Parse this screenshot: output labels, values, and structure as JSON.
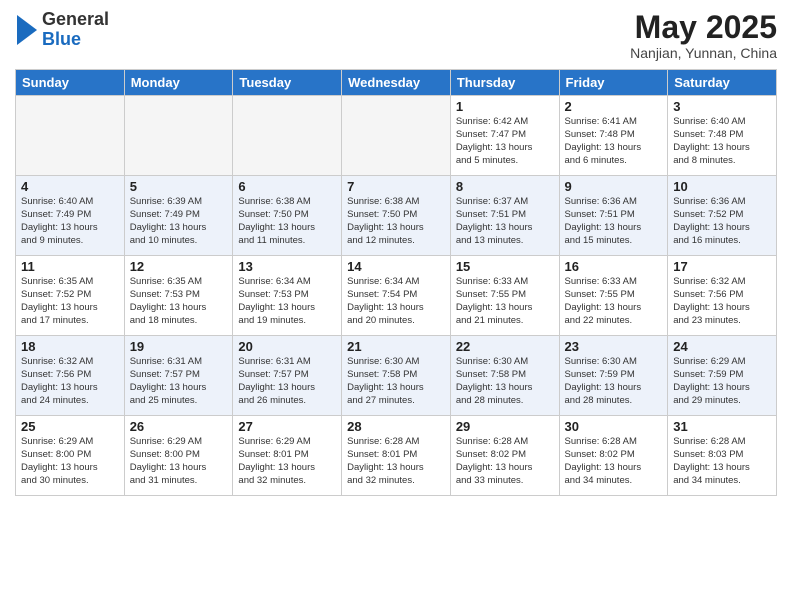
{
  "header": {
    "logo_general": "General",
    "logo_blue": "Blue",
    "month_year": "May 2025",
    "location": "Nanjian, Yunnan, China"
  },
  "weekdays": [
    "Sunday",
    "Monday",
    "Tuesday",
    "Wednesday",
    "Thursday",
    "Friday",
    "Saturday"
  ],
  "weeks": [
    [
      {
        "day": "",
        "info": ""
      },
      {
        "day": "",
        "info": ""
      },
      {
        "day": "",
        "info": ""
      },
      {
        "day": "",
        "info": ""
      },
      {
        "day": "1",
        "info": "Sunrise: 6:42 AM\nSunset: 7:47 PM\nDaylight: 13 hours\nand 5 minutes."
      },
      {
        "day": "2",
        "info": "Sunrise: 6:41 AM\nSunset: 7:48 PM\nDaylight: 13 hours\nand 6 minutes."
      },
      {
        "day": "3",
        "info": "Sunrise: 6:40 AM\nSunset: 7:48 PM\nDaylight: 13 hours\nand 8 minutes."
      }
    ],
    [
      {
        "day": "4",
        "info": "Sunrise: 6:40 AM\nSunset: 7:49 PM\nDaylight: 13 hours\nand 9 minutes."
      },
      {
        "day": "5",
        "info": "Sunrise: 6:39 AM\nSunset: 7:49 PM\nDaylight: 13 hours\nand 10 minutes."
      },
      {
        "day": "6",
        "info": "Sunrise: 6:38 AM\nSunset: 7:50 PM\nDaylight: 13 hours\nand 11 minutes."
      },
      {
        "day": "7",
        "info": "Sunrise: 6:38 AM\nSunset: 7:50 PM\nDaylight: 13 hours\nand 12 minutes."
      },
      {
        "day": "8",
        "info": "Sunrise: 6:37 AM\nSunset: 7:51 PM\nDaylight: 13 hours\nand 13 minutes."
      },
      {
        "day": "9",
        "info": "Sunrise: 6:36 AM\nSunset: 7:51 PM\nDaylight: 13 hours\nand 15 minutes."
      },
      {
        "day": "10",
        "info": "Sunrise: 6:36 AM\nSunset: 7:52 PM\nDaylight: 13 hours\nand 16 minutes."
      }
    ],
    [
      {
        "day": "11",
        "info": "Sunrise: 6:35 AM\nSunset: 7:52 PM\nDaylight: 13 hours\nand 17 minutes."
      },
      {
        "day": "12",
        "info": "Sunrise: 6:35 AM\nSunset: 7:53 PM\nDaylight: 13 hours\nand 18 minutes."
      },
      {
        "day": "13",
        "info": "Sunrise: 6:34 AM\nSunset: 7:53 PM\nDaylight: 13 hours\nand 19 minutes."
      },
      {
        "day": "14",
        "info": "Sunrise: 6:34 AM\nSunset: 7:54 PM\nDaylight: 13 hours\nand 20 minutes."
      },
      {
        "day": "15",
        "info": "Sunrise: 6:33 AM\nSunset: 7:55 PM\nDaylight: 13 hours\nand 21 minutes."
      },
      {
        "day": "16",
        "info": "Sunrise: 6:33 AM\nSunset: 7:55 PM\nDaylight: 13 hours\nand 22 minutes."
      },
      {
        "day": "17",
        "info": "Sunrise: 6:32 AM\nSunset: 7:56 PM\nDaylight: 13 hours\nand 23 minutes."
      }
    ],
    [
      {
        "day": "18",
        "info": "Sunrise: 6:32 AM\nSunset: 7:56 PM\nDaylight: 13 hours\nand 24 minutes."
      },
      {
        "day": "19",
        "info": "Sunrise: 6:31 AM\nSunset: 7:57 PM\nDaylight: 13 hours\nand 25 minutes."
      },
      {
        "day": "20",
        "info": "Sunrise: 6:31 AM\nSunset: 7:57 PM\nDaylight: 13 hours\nand 26 minutes."
      },
      {
        "day": "21",
        "info": "Sunrise: 6:30 AM\nSunset: 7:58 PM\nDaylight: 13 hours\nand 27 minutes."
      },
      {
        "day": "22",
        "info": "Sunrise: 6:30 AM\nSunset: 7:58 PM\nDaylight: 13 hours\nand 28 minutes."
      },
      {
        "day": "23",
        "info": "Sunrise: 6:30 AM\nSunset: 7:59 PM\nDaylight: 13 hours\nand 28 minutes."
      },
      {
        "day": "24",
        "info": "Sunrise: 6:29 AM\nSunset: 7:59 PM\nDaylight: 13 hours\nand 29 minutes."
      }
    ],
    [
      {
        "day": "25",
        "info": "Sunrise: 6:29 AM\nSunset: 8:00 PM\nDaylight: 13 hours\nand 30 minutes."
      },
      {
        "day": "26",
        "info": "Sunrise: 6:29 AM\nSunset: 8:00 PM\nDaylight: 13 hours\nand 31 minutes."
      },
      {
        "day": "27",
        "info": "Sunrise: 6:29 AM\nSunset: 8:01 PM\nDaylight: 13 hours\nand 32 minutes."
      },
      {
        "day": "28",
        "info": "Sunrise: 6:28 AM\nSunset: 8:01 PM\nDaylight: 13 hours\nand 32 minutes."
      },
      {
        "day": "29",
        "info": "Sunrise: 6:28 AM\nSunset: 8:02 PM\nDaylight: 13 hours\nand 33 minutes."
      },
      {
        "day": "30",
        "info": "Sunrise: 6:28 AM\nSunset: 8:02 PM\nDaylight: 13 hours\nand 34 minutes."
      },
      {
        "day": "31",
        "info": "Sunrise: 6:28 AM\nSunset: 8:03 PM\nDaylight: 13 hours\nand 34 minutes."
      }
    ]
  ]
}
